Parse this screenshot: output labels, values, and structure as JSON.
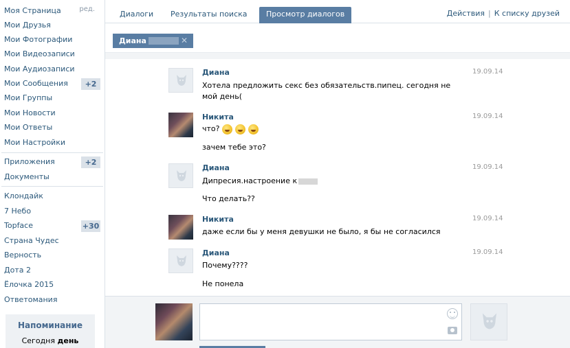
{
  "sidebar": {
    "edit": "ред.",
    "items": [
      {
        "label": "Моя Страница"
      },
      {
        "label": "Мои Друзья"
      },
      {
        "label": "Мои Фотографии"
      },
      {
        "label": "Мои Видеозаписи"
      },
      {
        "label": "Мои Аудиозаписи"
      },
      {
        "label": "Мои Сообщения",
        "badge": "+2"
      },
      {
        "label": "Мои Группы"
      },
      {
        "label": "Мои Новости"
      },
      {
        "label": "Мои Ответы"
      },
      {
        "label": "Мои Настройки"
      },
      {
        "label": "Приложения",
        "badge": "+2"
      },
      {
        "label": "Документы"
      },
      {
        "label": "Клондайк"
      },
      {
        "label": "7 Небо"
      },
      {
        "label": "Topface",
        "badge": "+30"
      },
      {
        "label": "Страна Чудес"
      },
      {
        "label": "Верность"
      },
      {
        "label": "Дота 2"
      },
      {
        "label": "Ёлочка 2015"
      },
      {
        "label": "Ответомания"
      }
    ],
    "reminder": {
      "title": "Напоминание",
      "text_prefix": "Сегодня ",
      "text_bold": "день"
    }
  },
  "tabs": [
    {
      "label": "Диалоги"
    },
    {
      "label": "Результаты поиска"
    },
    {
      "label": "Просмотр диалогов",
      "active": true
    }
  ],
  "actions": {
    "label": "Действия",
    "separator": "|",
    "friends_label": "К списку друзей"
  },
  "chip": {
    "name": "Диана",
    "close": "✕"
  },
  "messages": [
    {
      "author": "Диана",
      "date": "19.09.14",
      "lines": [
        "Хотела предложить секс без обязательств.пипец. сегодня не",
        "мой день("
      ]
    },
    {
      "author": "Никита",
      "date": "19.09.14",
      "lines": [
        "что?",
        "зачем тебе это?"
      ]
    },
    {
      "author": "Диана",
      "date": "19.09.14",
      "lines": [
        "Дипресия.настроение к",
        "Что делать??"
      ]
    },
    {
      "author": "Никита",
      "date": "19.09.14",
      "lines": [
        "даже если бы у меня девушки не было, я бы не согласился"
      ]
    },
    {
      "author": "Диана",
      "date": "19.09.14",
      "lines": [
        "Почему????",
        "Не понела"
      ]
    }
  ],
  "colors": {
    "accent": "#597da3",
    "link": "#2b587a",
    "badge_bg": "#dae1e8"
  }
}
